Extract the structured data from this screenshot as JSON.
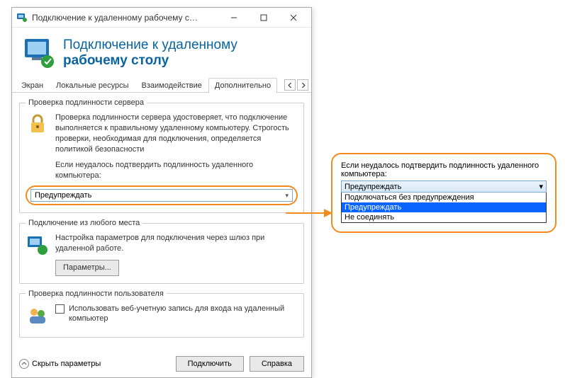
{
  "window": {
    "title": "Подключение к удаленному рабочему с…"
  },
  "banner": {
    "line1": "Подключение к удаленному",
    "line2": "рабочему столу"
  },
  "tabs": {
    "screen": "Экран",
    "local": "Локальные ресурсы",
    "interaction": "Взаимодействие",
    "advanced": "Дополнительно"
  },
  "groups": {
    "server_auth": {
      "legend": "Проверка подлинности сервера",
      "desc": "Проверка подлинности сервера удостоверяет, что подключение выполняется к правильному удаленному компьютеру. Строгость проверки, необходимая для подключения, определяется политикой безопасности",
      "prompt": "Если неудалось подтвердить подлинность удаленного компьютера:",
      "selected": "Предупреждать"
    },
    "gateway": {
      "legend": "Подключение из любого места",
      "desc": "Настройка параметров для подключения через шлюз при удаленной работе.",
      "button": "Параметры..."
    },
    "user_auth": {
      "legend": "Проверка подлинности пользователя",
      "checkbox_label": "Использовать веб-учетную запись для входа на удаленный компьютер"
    }
  },
  "footer": {
    "hide_opts": "Скрыть параметры",
    "connect": "Подключить",
    "help": "Справка"
  },
  "callout": {
    "prompt": "Если неудалось подтвердить подлинность удаленного компьютера:",
    "selected": "Предупреждать",
    "options": [
      "Подключаться без предупреждения",
      "Предупреждать",
      "Не соединять"
    ]
  },
  "colors": {
    "accent_blue": "#0a64a0",
    "highlight_orange": "#f28c1e",
    "selection_blue": "#0a64ff"
  }
}
